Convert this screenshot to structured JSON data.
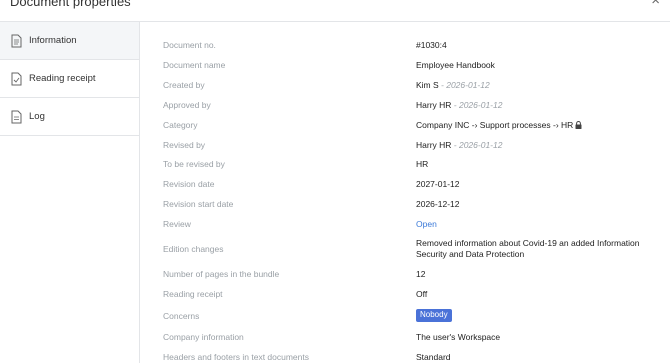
{
  "dialog": {
    "title": "Document properties",
    "close_symbol": "×"
  },
  "sidebar": {
    "items": [
      {
        "label": "Information",
        "icon": "document-icon",
        "active": true
      },
      {
        "label": "Reading receipt",
        "icon": "document-check-icon",
        "active": false
      },
      {
        "label": "Log",
        "icon": "document-lines-icon",
        "active": false
      }
    ]
  },
  "properties": {
    "document_no": {
      "label": "Document no.",
      "value": "#1030:4"
    },
    "document_name": {
      "label": "Document name",
      "value": "Employee Handbook"
    },
    "created_by": {
      "label": "Created by",
      "value": "Kim S",
      "date": " - 2026-01-12"
    },
    "approved_by": {
      "label": "Approved by",
      "value": "Harry HR",
      "date": " - 2026-01-12"
    },
    "category": {
      "label": "Category",
      "value": "Company INC -› Support processes -› HR",
      "icon": "lock-icon"
    },
    "revised_by": {
      "label": "Revised by",
      "value": "Harry HR",
      "date": " - 2026-01-12"
    },
    "to_be_revised_by": {
      "label": "To be revised by",
      "value": "HR"
    },
    "revision_date": {
      "label": "Revision date",
      "value": "2027-01-12"
    },
    "revision_start_date": {
      "label": "Revision start date",
      "value": "2026-12-12"
    },
    "review": {
      "label": "Review",
      "value": "Open"
    },
    "edition_changes": {
      "label": "Edition changes",
      "value": "Removed information about Covid-19 an added Information Security and Data Protection"
    },
    "pages_in_bundle": {
      "label": "Number of pages in the bundle",
      "value": "12"
    },
    "reading_receipt": {
      "label": "Reading receipt",
      "value": "Off"
    },
    "concerns": {
      "label": "Concerns",
      "value": "Nobody"
    },
    "company_information": {
      "label": "Company information",
      "value": "The user's Workspace"
    },
    "headers_footers": {
      "label": "Headers and footers in text documents",
      "value": "Standard"
    }
  },
  "colors": {
    "link": "#3d7bd9",
    "badge": "#4a72d8",
    "label": "#9aa0a6",
    "active_nav_bg": "#f4f6f8"
  }
}
